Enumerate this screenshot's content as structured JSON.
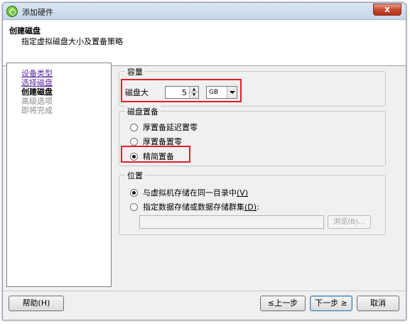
{
  "window": {
    "title": "添加硬件",
    "close_symbol": "x"
  },
  "header": {
    "title": "创建磁盘",
    "subtitle": "指定虚拟磁盘大小及置备策略"
  },
  "steps": [
    {
      "label": "设备类型",
      "state": "link"
    },
    {
      "label": "选择磁盘",
      "state": "link"
    },
    {
      "label": "创建磁盘",
      "state": "current"
    },
    {
      "label": "高级选项",
      "state": "disabled"
    },
    {
      "label": "即将完成",
      "state": "disabled"
    }
  ],
  "capacity": {
    "group_label": "容量",
    "disk_size_label": "磁盘大",
    "disk_size_value": "5",
    "unit_value": "GB"
  },
  "provisioning": {
    "group_label": "磁盘置备",
    "options": [
      {
        "label": "厚置备延迟置零",
        "selected": false
      },
      {
        "label": "厚置备置零",
        "selected": false
      },
      {
        "label": "精简置备",
        "selected": true
      }
    ]
  },
  "location": {
    "group_label": "位置",
    "option_same_dir": {
      "label": "与虚拟机存储在同一目录中",
      "hotkey": "(V)",
      "selected": true
    },
    "option_datastore": {
      "label": "指定数据存储或数据存储群集",
      "hotkey": "(D)",
      "suffix": ":",
      "selected": false
    },
    "datastore_value": "",
    "browse_label": "浏览(B)..."
  },
  "buttons": {
    "help": "帮助(H)",
    "back": "≤上一步",
    "next": "下一步 ≥",
    "cancel": "取消"
  },
  "colors": {
    "highlight_box": "#e0202a",
    "link": "#5a2aa0"
  }
}
